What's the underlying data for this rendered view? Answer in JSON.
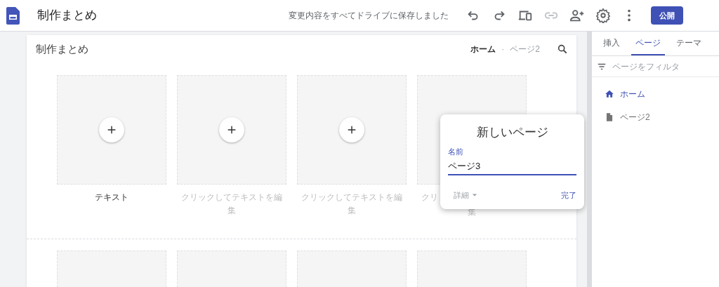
{
  "app_bar": {
    "title": "制作まとめ",
    "save_status": "変更内容をすべてドライブに保存しました",
    "publish_button": "公開"
  },
  "canvas": {
    "site_title": "制作まとめ",
    "nav_separator": "·",
    "nav": [
      {
        "label": "ホーム",
        "selected": true
      },
      {
        "label": "ページ2",
        "selected": false
      }
    ],
    "sections": [
      {
        "tiles": [
          {
            "kind": "add",
            "caption_lines": [
              "テキスト"
            ],
            "placeholder": false
          },
          {
            "kind": "add",
            "caption_lines": [
              "クリックしてテキストを編",
              "集"
            ],
            "placeholder": true
          },
          {
            "kind": "add",
            "caption_lines": [
              "クリックしてテキストを編",
              "集"
            ],
            "placeholder": true
          },
          {
            "kind": "covered",
            "caption_lines": [
              "クリ",
              "集"
            ],
            "placeholder": true
          }
        ]
      },
      {
        "tiles": [
          {
            "kind": "empty"
          },
          {
            "kind": "empty"
          },
          {
            "kind": "empty"
          },
          {
            "kind": "empty"
          }
        ]
      }
    ]
  },
  "new_page_dialog": {
    "title": "新しいページ",
    "field_label": "名前",
    "value": "ページ3",
    "details": "詳細",
    "done": "完了"
  },
  "side_panel": {
    "tabs": [
      {
        "label": "挿入",
        "selected": false
      },
      {
        "label": "ページ",
        "selected": true
      },
      {
        "label": "テーマ",
        "selected": false
      }
    ],
    "filter_placeholder": "ページをフィルタ",
    "pages": [
      {
        "kind": "home",
        "label": "ホーム",
        "selected": true
      },
      {
        "kind": "page",
        "label": "ページ2",
        "selected": false
      }
    ]
  }
}
